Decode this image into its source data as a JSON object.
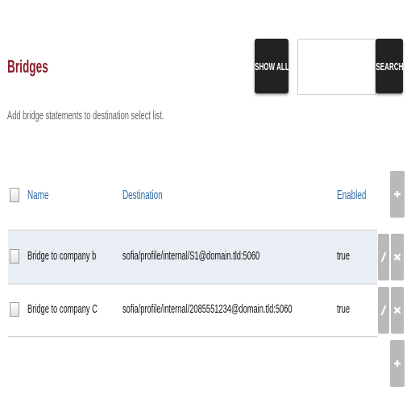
{
  "page": {
    "title": "Bridges",
    "description": "Add bridge statements to destination select list."
  },
  "toolbar": {
    "show_all_label": "SHOW ALL",
    "search_value": "",
    "search_label": "SEARCH"
  },
  "table": {
    "columns": {
      "name": "Name",
      "destination": "Destination",
      "enabled": "Enabled"
    },
    "rows": [
      {
        "name": "Bridge to company b",
        "destination": "sofia/profile/internal/S1@domain.tld:5060",
        "enabled": "true"
      },
      {
        "name": "Bridge to company C",
        "destination": "sofia/profile/internal/2085551234@domain.tld:5060",
        "enabled": "true"
      }
    ]
  },
  "icons": {
    "add": "plus-icon",
    "edit": "pencil-icon",
    "delete": "x-icon"
  },
  "colors": {
    "title": "#8b1e2b",
    "header_link": "#2f6aa6",
    "dark_button": "#222222",
    "action_button": "#b9b9b9",
    "row_highlight": "#e9edf4"
  }
}
